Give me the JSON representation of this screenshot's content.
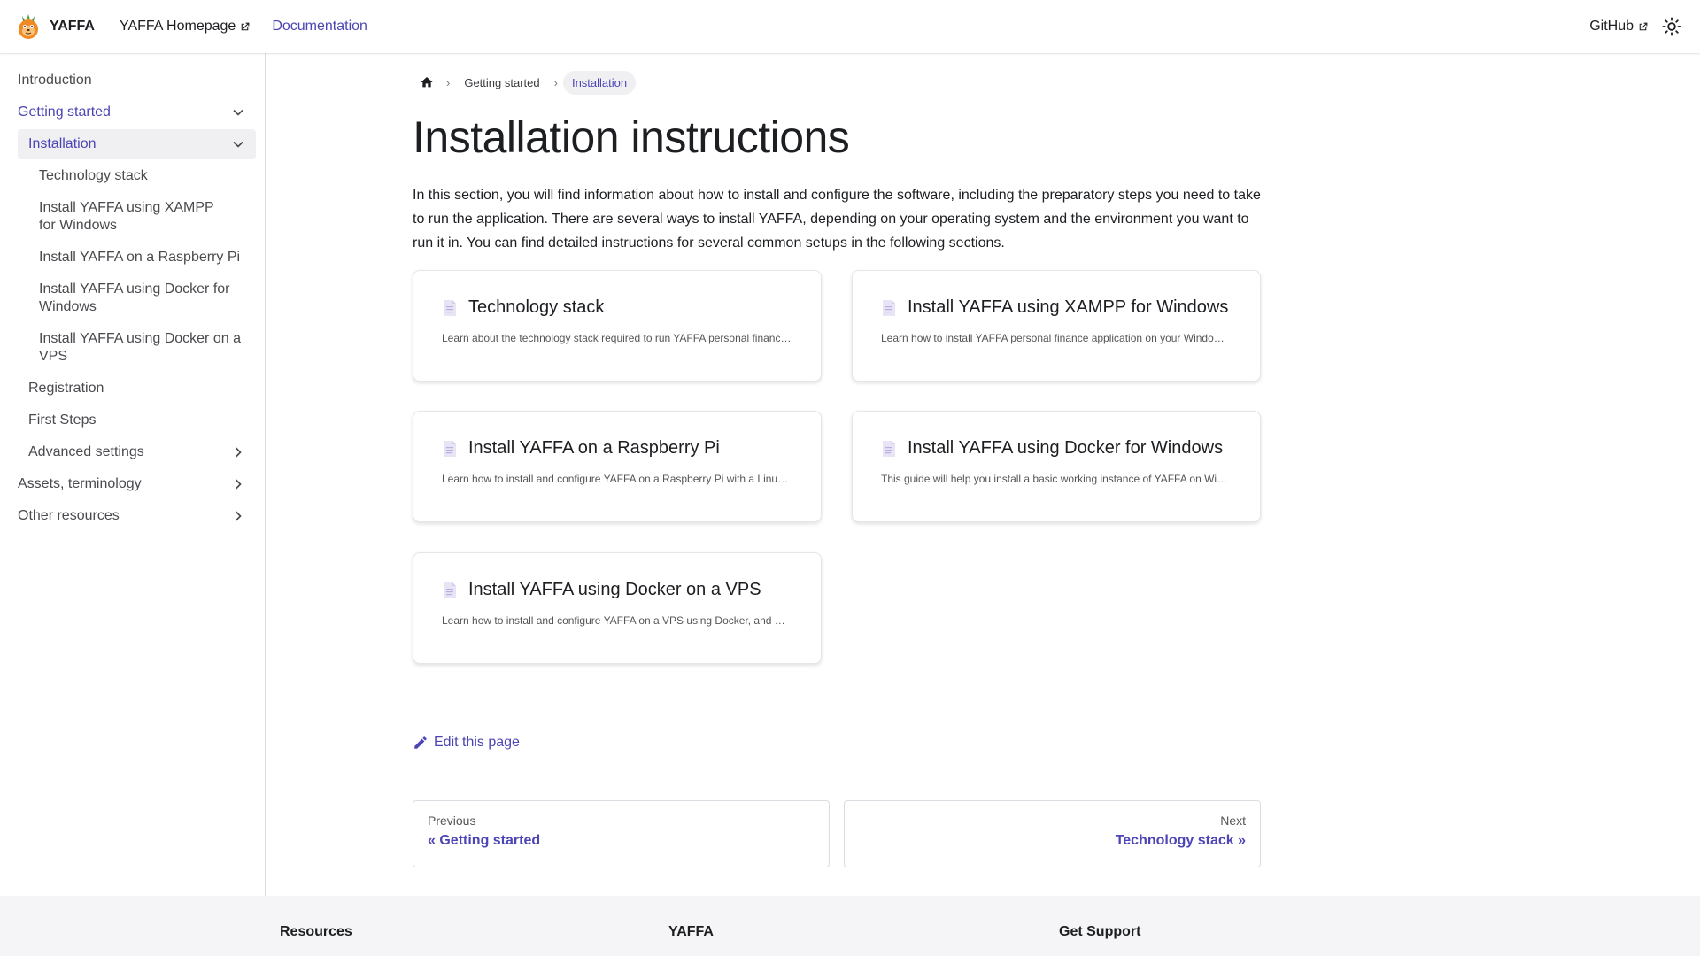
{
  "navbar": {
    "brand": "YAFFA",
    "links": [
      {
        "label": "YAFFA Homepage",
        "external": true
      },
      {
        "label": "Documentation",
        "active": true
      }
    ],
    "github": "GitHub"
  },
  "sidebar": {
    "items": [
      {
        "label": "Introduction"
      },
      {
        "label": "Getting started"
      },
      {
        "label": "Installation"
      },
      {
        "label": "Technology stack"
      },
      {
        "label": "Install YAFFA using XAMPP for Windows"
      },
      {
        "label": "Install YAFFA on a Raspberry Pi"
      },
      {
        "label": "Install YAFFA using Docker for Windows"
      },
      {
        "label": "Install YAFFA using Docker on a VPS"
      },
      {
        "label": "Registration"
      },
      {
        "label": "First Steps"
      },
      {
        "label": "Advanced settings"
      },
      {
        "label": "Assets, terminology"
      },
      {
        "label": "Other resources"
      }
    ]
  },
  "breadcrumbs": [
    "Getting started",
    "Installation"
  ],
  "page": {
    "title": "Installation instructions",
    "intro": "In this section, you will find information about how to install and configure the software, including the preparatory steps you need to take to run the application. There are several ways to install YAFFA, depending on your operating system and the environment you want to run it in. You can find detailed instructions for several common setups in the following sections."
  },
  "cards": [
    {
      "title": "Technology stack",
      "desc": "Learn about the technology stack required to run YAFFA personal finance application"
    },
    {
      "title": "Install YAFFA using XAMPP for Windows",
      "desc": "Learn how to install YAFFA personal finance application on your Windows computer using XAMPP"
    },
    {
      "title": "Install YAFFA on a Raspberry Pi",
      "desc": "Learn how to install and configure YAFFA on a Raspberry Pi with a Linux based system"
    },
    {
      "title": "Install YAFFA using Docker for Windows",
      "desc": "This guide will help you install a basic working instance of YAFFA on Windows using Docker"
    },
    {
      "title": "Install YAFFA using Docker on a VPS",
      "desc": "Learn how to install and configure YAFFA on a VPS using Docker, and make it accessible"
    }
  ],
  "edit_link": "Edit this page",
  "pager": {
    "prev_sub": "Previous",
    "prev_label": "« Getting started",
    "next_sub": "Next",
    "next_label": "Technology stack »"
  },
  "footer": {
    "columns": [
      "Resources",
      "YAFFA",
      "Get Support"
    ]
  },
  "colors": {
    "accent": "#4c45b5",
    "border": "#dadde1",
    "footer_bg": "#f5f5f7"
  }
}
